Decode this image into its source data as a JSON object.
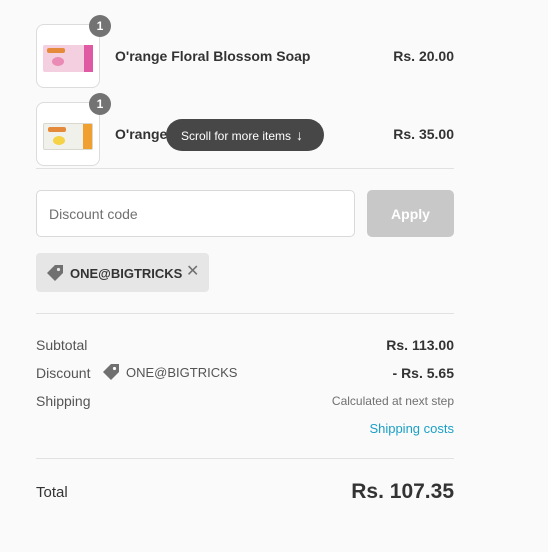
{
  "products": [
    {
      "name": "O'range Floral Blossom Soap",
      "price": "Rs. 20.00",
      "quantity": "1",
      "thumb_color": "#f4cfe0",
      "thumb_icon": "soap-box-pink-icon"
    },
    {
      "name": "O'range Gi",
      "price": "Rs. 35.00",
      "quantity": "1",
      "thumb_color": "#f1f1ec",
      "thumb_icon": "soap-box-white-icon"
    }
  ],
  "scroll_hint": {
    "label": "Scroll for more items",
    "icon": "arrow-down-icon",
    "arrow": "↓"
  },
  "discount": {
    "placeholder": "Discount code",
    "apply_label": "Apply",
    "applied_code": "ONE@BIGTRICKS",
    "tag_icon": "price-tag-icon",
    "remove_icon": "close-icon",
    "remove_glyph": "✕"
  },
  "summary": {
    "subtotal_label": "Subtotal",
    "subtotal_value": "Rs. 113.00",
    "discount_label": "Discount",
    "discount_code": "ONE@BIGTRICKS",
    "discount_value": "- Rs. 5.65",
    "shipping_label": "Shipping",
    "shipping_value": "Calculated at next step",
    "shipping_link": "Shipping costs",
    "total_label": "Total",
    "total_value": "Rs. 107.35"
  },
  "colors": {
    "link": "#1a9fc6",
    "badge": "#737373",
    "apply_disabled": "#c8c8c8",
    "toast": "#474747"
  }
}
